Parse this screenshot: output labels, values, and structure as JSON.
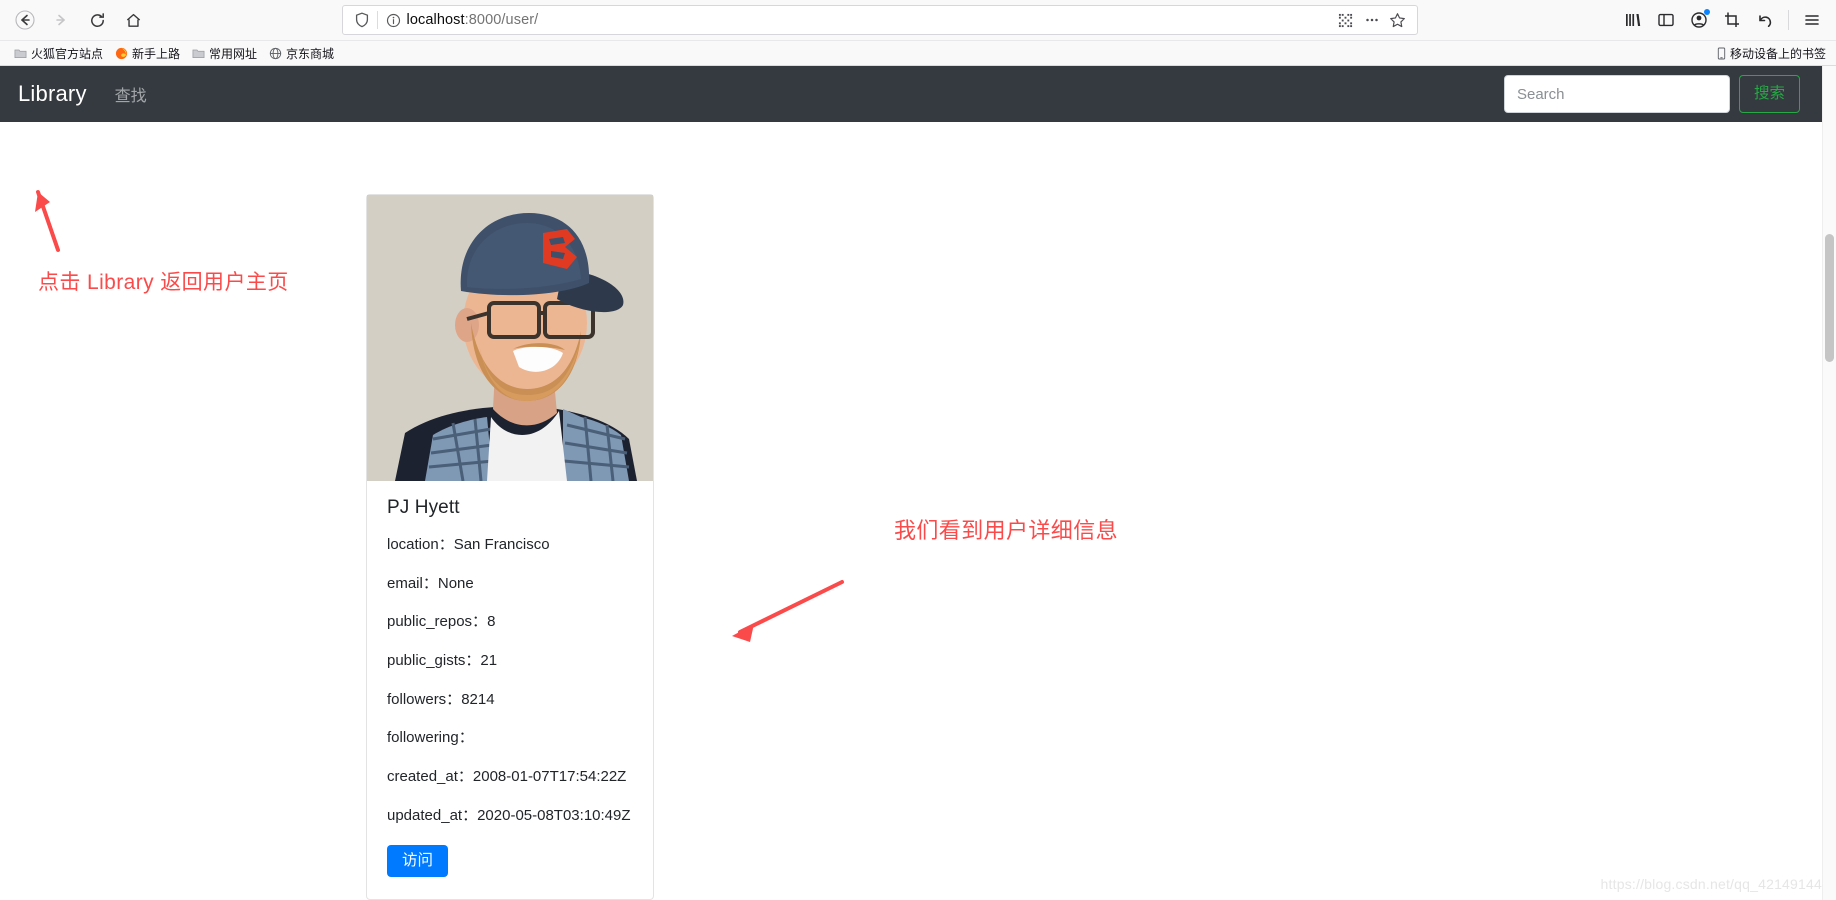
{
  "browser": {
    "nav": {
      "back_label": "Back",
      "forward_label": "Forward",
      "reload_label": "Reload",
      "home_label": "Home"
    },
    "url": {
      "host": "localhost",
      "path": ":8000/user/",
      "full": "localhost:8000/user/"
    },
    "urlbar_icons": [
      "shield-icon",
      "page-info-icon",
      "qrcode-icon",
      "ellipsis-icon",
      "star-icon"
    ],
    "toolbar_icons": [
      "library-icon",
      "sidebar-icon",
      "account-icon",
      "screenshot-icon",
      "undo-icon",
      "hamburger-menu-icon"
    ],
    "bookmarks": [
      {
        "label": "火狐官方站点",
        "icon": "folder-icon"
      },
      {
        "label": "新手上路",
        "icon": "firefox-icon"
      },
      {
        "label": "常用网址",
        "icon": "folder-icon"
      },
      {
        "label": "京东商城",
        "icon": "globe-icon"
      }
    ],
    "bookmarks_right": {
      "label": "移动设备上的书签",
      "icon": "mobile-icon"
    }
  },
  "navbar": {
    "brand": "Library",
    "links": [
      {
        "label": "查找"
      }
    ],
    "search": {
      "placeholder": "Search",
      "value": "",
      "button_label": "搜索"
    }
  },
  "card": {
    "avatar_alt": "PJ Hyett avatar",
    "title": "PJ Hyett",
    "fields": [
      {
        "key": "location",
        "label": "location：",
        "value": "San Francisco"
      },
      {
        "key": "email",
        "label": "email：",
        "value": "None"
      },
      {
        "key": "public_repos",
        "label": "public_repos：",
        "value": "8"
      },
      {
        "key": "public_gists",
        "label": "public_gists：",
        "value": "21"
      },
      {
        "key": "followers",
        "label": "followers：",
        "value": "8214"
      },
      {
        "key": "followering",
        "label": "followering：",
        "value": ""
      },
      {
        "key": "created_at",
        "label": "created_at：",
        "value": "2008-01-07T17:54:22Z"
      },
      {
        "key": "updated_at",
        "label": "updated_at：",
        "value": "2020-05-08T03:10:49Z"
      }
    ],
    "visit_button_label": "访问"
  },
  "annotations": [
    {
      "id": "annot-library",
      "text": "点击 Library 返回用户主页",
      "color": "#fb4a4a"
    },
    {
      "id": "annot-details",
      "text": "我们看到用户详细信息",
      "color": "#fb4a4a"
    }
  ],
  "watermark": "https://blog.csdn.net/qq_42149144",
  "colors": {
    "navbar_bg": "#343a40",
    "search_button": "#28a745",
    "visit_button": "#007bff",
    "annotation_red": "#fb4a4a"
  }
}
